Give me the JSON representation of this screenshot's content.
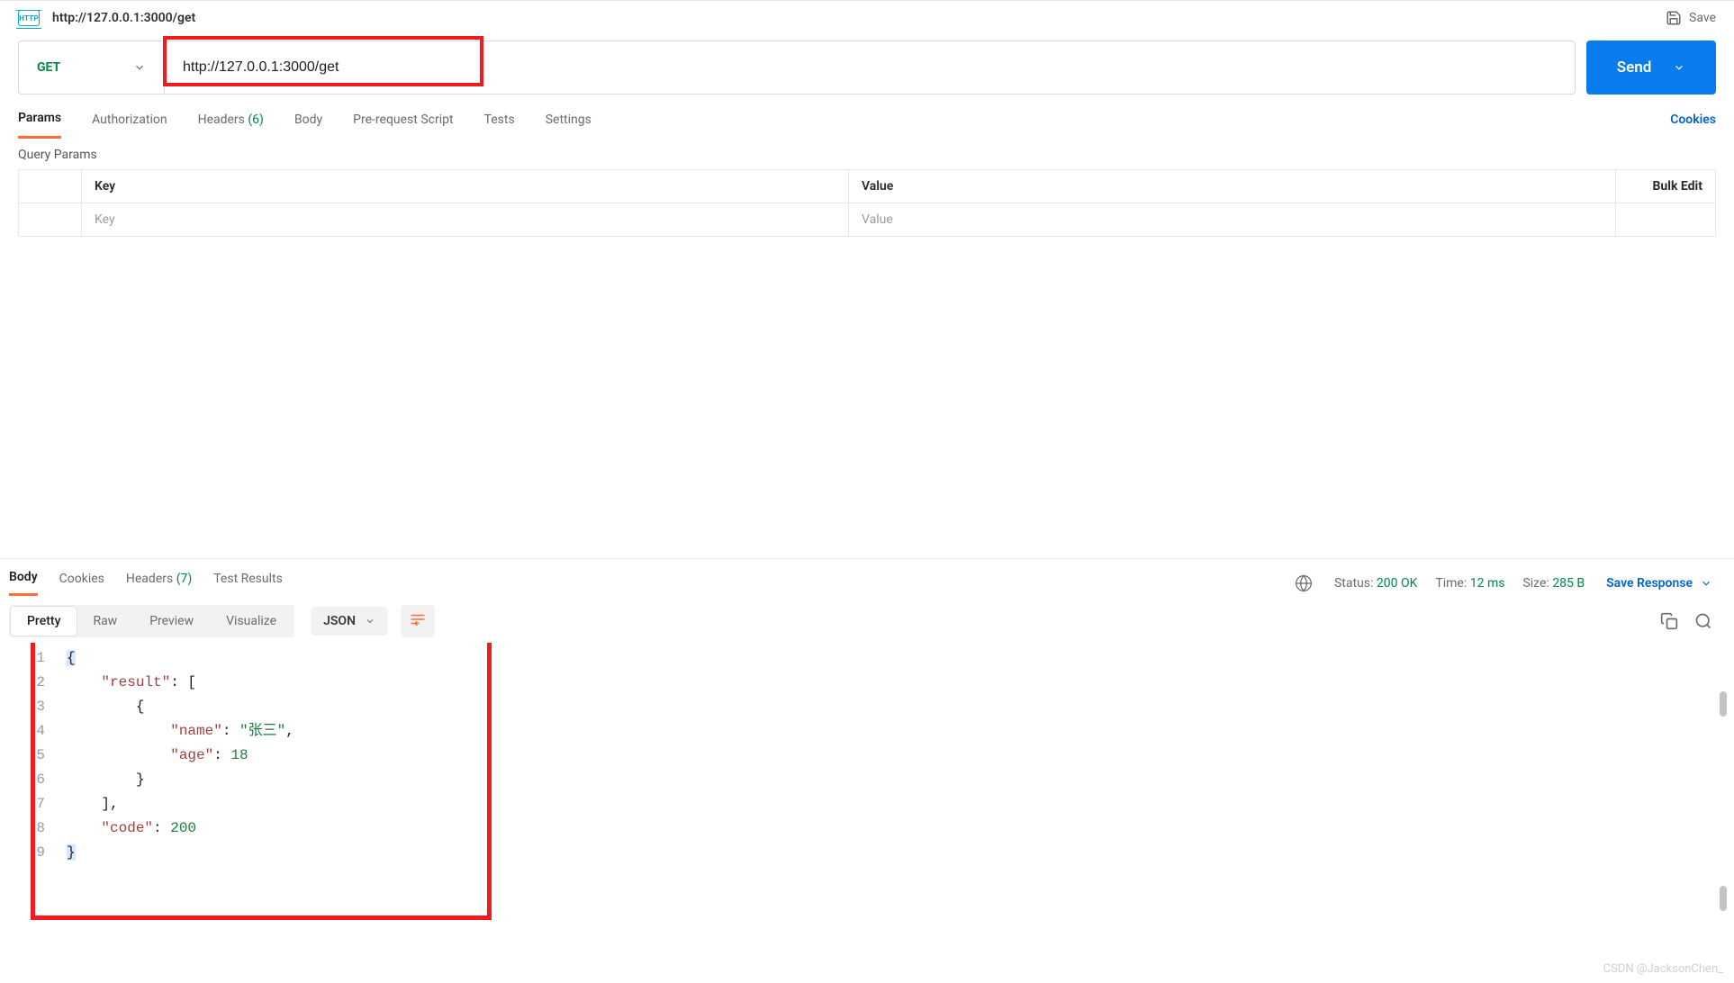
{
  "header": {
    "title": "http://127.0.0.1:3000/get",
    "save_label": "Save"
  },
  "request": {
    "method": "GET",
    "url": "http://127.0.0.1:3000/get",
    "send_label": "Send",
    "tabs": {
      "params": "Params",
      "auth": "Authorization",
      "headers": "Headers",
      "headers_count": "(6)",
      "body": "Body",
      "prerequest": "Pre-request Script",
      "tests": "Tests",
      "settings": "Settings",
      "cookies": "Cookies"
    },
    "query_params_label": "Query Params",
    "table": {
      "key_header": "Key",
      "value_header": "Value",
      "bulk_edit": "Bulk Edit",
      "key_placeholder": "Key",
      "value_placeholder": "Value"
    }
  },
  "response": {
    "tabs": {
      "body": "Body",
      "cookies": "Cookies",
      "headers": "Headers",
      "headers_count": "(7)",
      "test_results": "Test Results"
    },
    "status_label": "Status:",
    "status_value": "200 OK",
    "time_label": "Time:",
    "time_value": "12 ms",
    "size_label": "Size:",
    "size_value": "285 B",
    "save_response": "Save Response",
    "view_tabs": {
      "pretty": "Pretty",
      "raw": "Raw",
      "preview": "Preview",
      "visualize": "Visualize"
    },
    "content_type": "JSON",
    "code_lines": [
      "1",
      "2",
      "3",
      "4",
      "5",
      "6",
      "7",
      "8",
      "9"
    ],
    "json_body": {
      "result": [
        {
          "name": "张三",
          "age": 18
        }
      ],
      "code": 200
    }
  },
  "watermark": "CSDN @JacksonChen_"
}
